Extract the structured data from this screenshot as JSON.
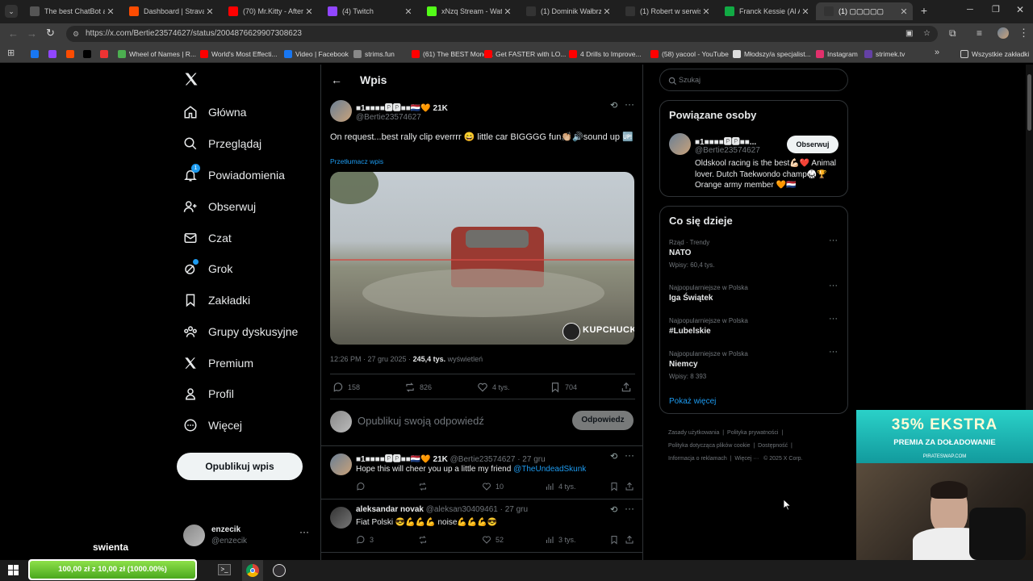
{
  "tabs": [
    {
      "label": "The best ChatBot and",
      "color": "#555"
    },
    {
      "label": "Dashboard | Strava",
      "color": "#fc4c02"
    },
    {
      "label": "(70) Mr.Kitty - After D",
      "color": "#ff0000"
    },
    {
      "label": "(4) Twitch",
      "color": "#9146ff"
    },
    {
      "label": "xNzq Stream - Watch",
      "color": "#53fc18"
    },
    {
      "label": "(1) Dominik Wałbrzy",
      "color": "#333"
    },
    {
      "label": "(1) Robert w serwisie",
      "color": "#333"
    },
    {
      "label": "Franck Kessie (Al Ahl",
      "color": "#1a4"
    },
    {
      "label": "(1) ▢▢▢▢▢",
      "color": "#333"
    }
  ],
  "url": "https://x.com/Bertie23574627/status/2004876629907308623",
  "bookmarks": [
    {
      "label": "",
      "color": "#1877f2"
    },
    {
      "label": "",
      "color": "#9146ff"
    },
    {
      "label": "",
      "color": "#fc4c02"
    },
    {
      "label": "",
      "color": "#000"
    },
    {
      "label": "",
      "color": "#e33"
    },
    {
      "label": "Wheel of Names | R...",
      "color": "#4caf50"
    },
    {
      "label": "World's Most Effecti...",
      "color": "#ff0000"
    },
    {
      "label": "Video | Facebook",
      "color": "#1877f2"
    },
    {
      "label": "strims.fun",
      "color": "#888"
    },
    {
      "label": "(61) The BEST Mone...",
      "color": "#ff0000"
    },
    {
      "label": "Get FASTER with LO...",
      "color": "#ff0000"
    },
    {
      "label": "4 Drills to Improve...",
      "color": "#ff0000"
    },
    {
      "label": "(58) yacool - YouTube",
      "color": "#ff0000"
    },
    {
      "label": "Młodszy/a specjalist...",
      "color": "#ddd"
    },
    {
      "label": "Instagram",
      "color": "#e1306c"
    },
    {
      "label": "strimek.tv",
      "color": "#6441a5"
    }
  ],
  "bookmarks_all": "Wszystkie zakładki",
  "nav": {
    "home": "Główna",
    "explore": "Przeglądaj",
    "notifications": "Powiadomienia",
    "notif_badge": "1",
    "follow": "Obserwuj",
    "chat": "Czat",
    "grok": "Grok",
    "bookmarks": "Zakładki",
    "groups": "Grupy dyskusyjne",
    "premium": "Premium",
    "profile": "Profil",
    "more": "Więcej",
    "post_button": "Opublikuj wpis"
  },
  "account": {
    "name": "enzecik",
    "handle": "@enzecik"
  },
  "overlay_text": "swienta",
  "header": {
    "title": "Wpis"
  },
  "post": {
    "author_name": "■1■■■■🅿🅿■■🇳🇱🧡 21K",
    "handle": "@Bertie23574627",
    "text": "On request...best rally clip everrrr 😄 little car BIGGGG fun👏🏼🔊sound up 🆙",
    "translate": "Przetłumacz wpis",
    "watermark": "KUPCHUCK",
    "time": "12:26 PM · 27 gru 2025 · ",
    "views": "245,4 tys.",
    "views_label": " wyświetleń",
    "replies": "158",
    "reposts": "826",
    "likes": "4 tys.",
    "saves": "704"
  },
  "reply_box": {
    "placeholder": "Opublikuj swoją odpowiedź",
    "button": "Odpowiedz"
  },
  "replies": [
    {
      "name": "■1■■■■🅿🅿■■🇳🇱🧡 21K",
      "meta": "@Bertie23574627 · 27 gru",
      "text_a": "Hope this will cheer you up a little my friend ",
      "mention": "@TheUndeadSkunk",
      "reply": "",
      "repost": "",
      "like": "10",
      "views": "4 tys."
    },
    {
      "name": "aleksandar novak",
      "meta": "@aleksan30409461 · 27 gru",
      "text_a": "Fiat Polski 😎💪💪💪 noise💪💪💪😎",
      "mention": "",
      "reply": "3",
      "repost": "",
      "like": "52",
      "views": "3 tys."
    }
  ],
  "search": {
    "placeholder": "Szukaj"
  },
  "related": {
    "title": "Powiązane osoby",
    "name": "■1■■■■🅿🅿■■...",
    "handle": "@Bertie23574627",
    "follow": "Obserwuj",
    "bio": "Oldskool racing is the best💪🏻❤️ Animal lover. Dutch Taekwondo champ🥋🏆 Orange army member 🧡🇳🇱"
  },
  "trends": {
    "title": "Co się dzieje",
    "items": [
      {
        "context": "Rząd · Trendy",
        "name": "NATO",
        "count": "Wpisy: 60,4 tys."
      },
      {
        "context": "Najpopularniejsze w Polska",
        "name": "Iga Świątek",
        "count": ""
      },
      {
        "context": "Najpopularniejsze w Polska",
        "name": "#Lubelskie",
        "count": ""
      },
      {
        "context": "Najpopularniejsze w Polska",
        "name": "Niemcy",
        "count": "Wpisy: 8 393"
      }
    ],
    "more": "Pokaż więcej"
  },
  "footer": {
    "l1a": "Zasady użytkowania",
    "l1b": "Polityka prywatności",
    "l2a": "Polityka dotycząca plików cookie",
    "l2b": "Dostępność",
    "l3a": "Informacja o reklamach",
    "l3b": "Więcej ···",
    "l3c": "© 2025 X Corp."
  },
  "ad": {
    "headline": "35% EKSTRA",
    "sub": "PREMIA ZA DOŁADOWANIE",
    "site": "PIRATESWAP.COM"
  },
  "taskbar": {
    "progress": "100,00 zł z 10,00 zł (1000.00%)"
  },
  "colors": {
    "accent": "#1d9bf0",
    "bg": "#000000",
    "border": "#2f3336",
    "muted": "#71767b",
    "ad": "#2ad1c8"
  }
}
